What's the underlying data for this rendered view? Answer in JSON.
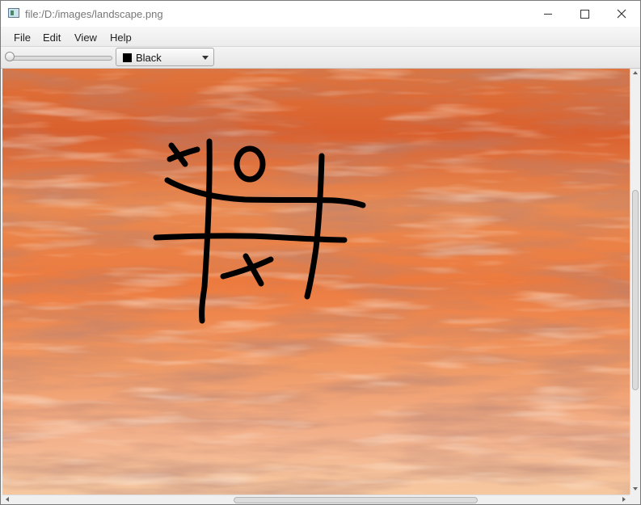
{
  "window": {
    "title": "file:/D:/images/landscape.png",
    "controls": {
      "minimize": "minimize",
      "maximize": "maximize",
      "close": "close"
    }
  },
  "menu": {
    "items": [
      {
        "label": "File"
      },
      {
        "label": "Edit"
      },
      {
        "label": "View"
      },
      {
        "label": "Help"
      }
    ]
  },
  "toolbar": {
    "brush_size_level": 0.0,
    "color_select": {
      "selected": "Black",
      "swatch_color": "#000000"
    }
  },
  "canvas": {
    "image": "sunset-clouds-landscape",
    "drawing": "tic-tac-toe sketch",
    "stroke_color": "#000000",
    "sky_colors": {
      "light": "#f6b07a",
      "mid": "#e8743a",
      "dark": "#9c4a34"
    }
  },
  "icons": {
    "app": "image-app-icon",
    "minimize": "minimize-icon",
    "maximize": "maximize-icon",
    "close": "close-icon",
    "dropdown": "chevron-down-icon"
  }
}
